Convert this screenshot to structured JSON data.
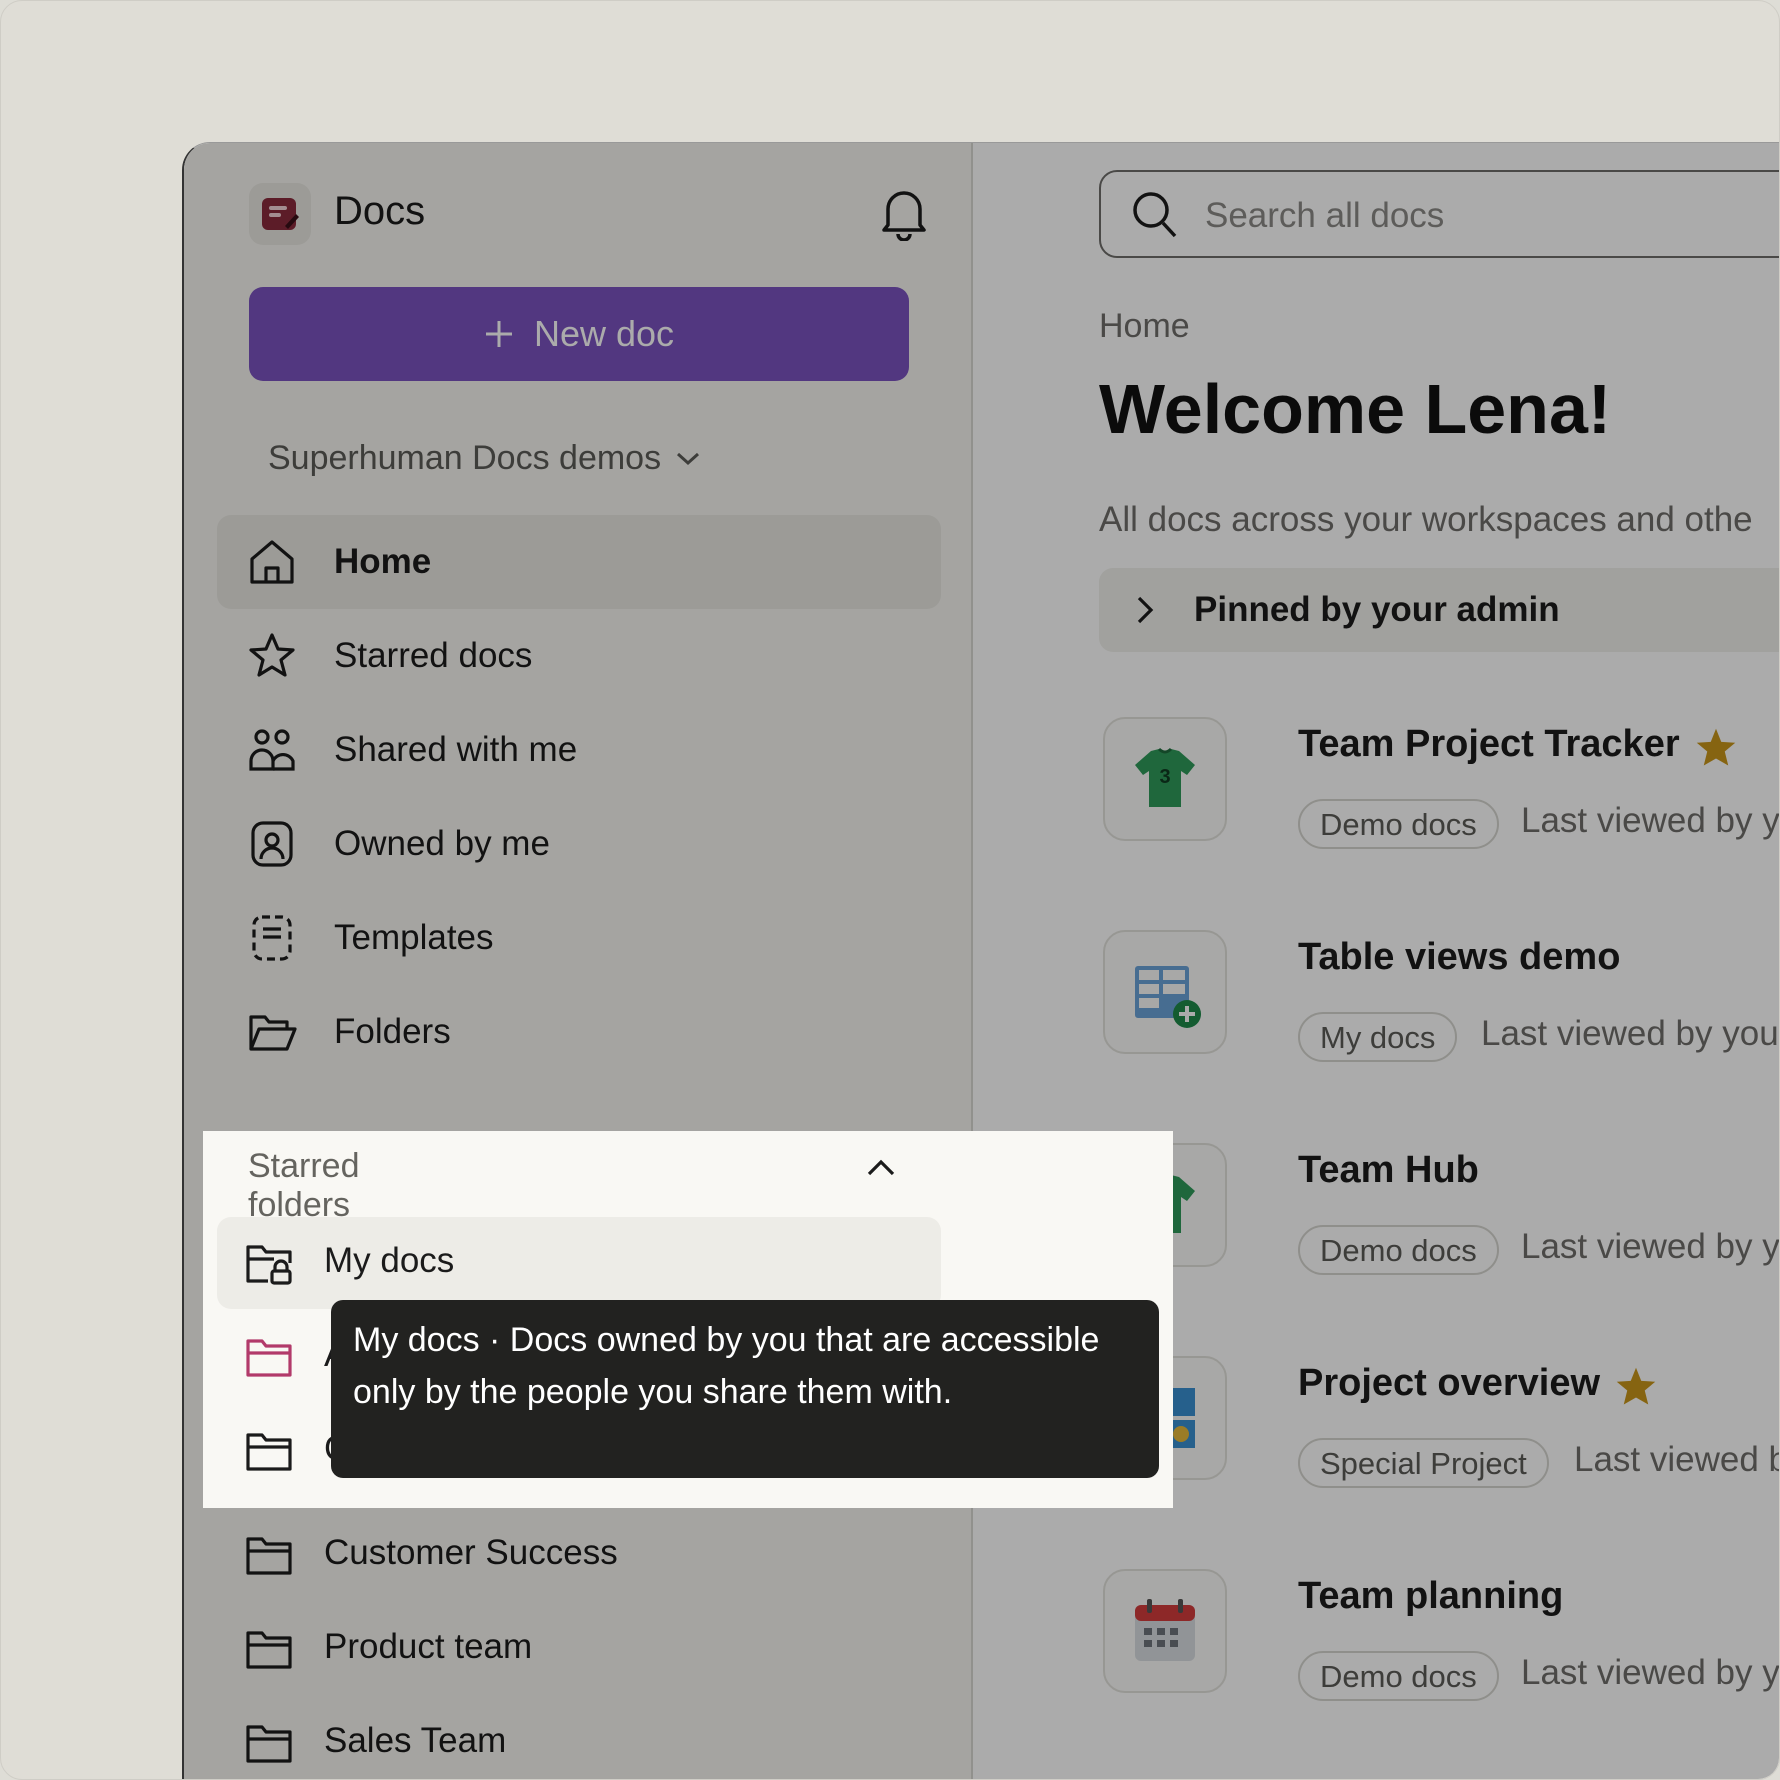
{
  "app": {
    "title": "Docs"
  },
  "sidebar": {
    "new_doc_label": "New doc",
    "workspace": "Superhuman Docs demos",
    "nav": [
      {
        "label": "Home",
        "icon": "home-icon"
      },
      {
        "label": "Starred docs",
        "icon": "star-icon"
      },
      {
        "label": "Shared with me",
        "icon": "people-icon"
      },
      {
        "label": "Owned by me",
        "icon": "user-badge-icon"
      },
      {
        "label": "Templates",
        "icon": "template-icon"
      },
      {
        "label": "Folders",
        "icon": "folder-open-icon"
      }
    ],
    "starred_title": "Starred folders",
    "folders": [
      {
        "label": "My docs",
        "icon": "locked-folder-icon"
      },
      {
        "label": "A",
        "icon": "folder-icon",
        "color": "#b23a6a"
      },
      {
        "label": "C",
        "icon": "folder-icon"
      },
      {
        "label": "Customer Success",
        "icon": "folder-icon"
      },
      {
        "label": "Product team",
        "icon": "folder-icon"
      },
      {
        "label": "Sales Team",
        "icon": "folder-icon"
      }
    ]
  },
  "tooltip": {
    "text": "My docs · Docs owned by you that are accessible only by the people you share them with."
  },
  "main": {
    "search_placeholder": "Search all docs",
    "breadcrumb": "Home",
    "welcome": "Welcome Lena!",
    "subtitle": "All docs across your workspaces and othe",
    "pinned": "Pinned by your admin",
    "docs": [
      {
        "name": "Team Project Tracker",
        "starred": true,
        "tag": "Demo docs",
        "meta": "Last viewed by y",
        "icon": "jersey-icon"
      },
      {
        "name": "Table views demo",
        "starred": false,
        "tag": "My docs",
        "meta": "Last viewed by you",
        "icon": "table-add-icon"
      },
      {
        "name": "Team Hub",
        "starred": false,
        "tag": "Demo docs",
        "meta": "Last viewed by y",
        "icon": "jersey-icon"
      },
      {
        "name": "Project overview",
        "starred": true,
        "tag": "Special Project",
        "meta": "Last viewed b",
        "icon": "dashboard-icon"
      },
      {
        "name": "Team planning",
        "starred": false,
        "tag": "Demo docs",
        "meta": "Last viewed by y",
        "icon": "calendar-icon"
      }
    ]
  },
  "colors": {
    "accent": "#7b53bf",
    "star": "#c8961a",
    "overlay": "rgba(0,0,0,0.33)"
  }
}
